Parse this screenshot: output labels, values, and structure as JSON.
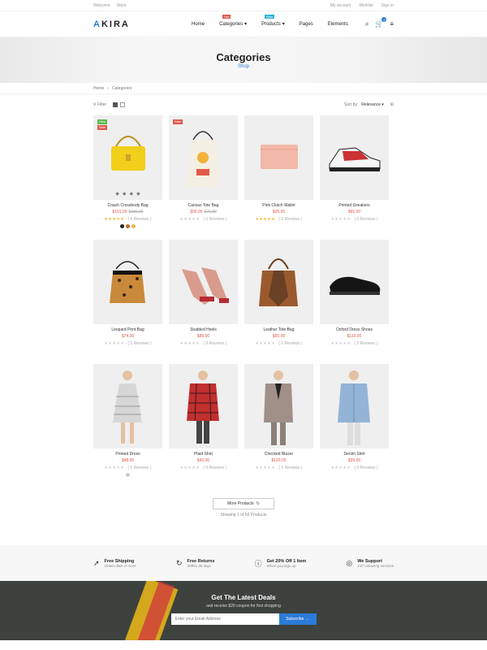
{
  "topbar": {
    "left": [
      "Welcome",
      "Store"
    ],
    "right": [
      "My account",
      "Wishlist",
      "Sign in"
    ]
  },
  "header": {
    "logo_a": "A",
    "logo_rest": "KIRA",
    "cart_count": "2",
    "nav": [
      {
        "label": "Home",
        "tag": ""
      },
      {
        "label": "Categories",
        "tag": "Hot",
        "tag_color": "#e0584b"
      },
      {
        "label": "Products",
        "tag": "New",
        "tag_color": "#2bb2d8"
      },
      {
        "label": "Pages",
        "tag": ""
      },
      {
        "label": "Elements",
        "tag": ""
      }
    ]
  },
  "hero": {
    "title": "Categories",
    "subtitle": "Shop"
  },
  "breadcrumb": {
    "home": "Home",
    "sep": "›",
    "current": "Categories"
  },
  "toolbar": {
    "filter": "Filter",
    "sort_label": "Sort by:",
    "sort_value": "Relevance"
  },
  "products": [
    {
      "name": "Coach Crossbody Bag",
      "price": "$101.00",
      "old": "$180.00",
      "badges": [
        {
          "t": "New",
          "c": "#59b84f"
        },
        {
          "t": "Sale",
          "c": "#e0584b"
        }
      ],
      "stars": "★★★★★",
      "gold": true,
      "reviews": "( 4 Reviews )",
      "swatches": [
        "#222",
        "#c06a2a",
        "#e8b64a"
      ],
      "img": "yellowbag"
    },
    {
      "name": "Canvas Tote Bag",
      "price": "$55.00",
      "old": "$70.00",
      "badges": [
        {
          "t": "Sale",
          "c": "#e0584b"
        }
      ],
      "stars": "★★★★★",
      "gold": false,
      "reviews": "( 0 Reviews )",
      "swatches": [],
      "img": "tote"
    },
    {
      "name": "Pink Clutch Wallet",
      "price": "$35.00",
      "old": "",
      "badges": [],
      "stars": "★★★★★",
      "gold": true,
      "reviews": "( 2 Reviews )",
      "swatches": [],
      "img": "clutch"
    },
    {
      "name": "Printed Sneakers",
      "price": "$65.00",
      "old": "",
      "badges": [],
      "stars": "★★★★★",
      "gold": false,
      "reviews": "( 0 Reviews )",
      "swatches": [],
      "img": "sneaker"
    },
    {
      "name": "Leopard Print Bag",
      "price": "$74.00",
      "old": "",
      "badges": [],
      "stars": "★★★★★",
      "gold": false,
      "reviews": "( 0 Reviews )",
      "swatches": [],
      "img": "leopard"
    },
    {
      "name": "Studded Heels",
      "price": "$89.00",
      "old": "",
      "badges": [],
      "stars": "★★★★★",
      "gold": false,
      "reviews": "( 0 Reviews )",
      "swatches": [],
      "img": "heels"
    },
    {
      "name": "Leather Tote Bag",
      "price": "$95.00",
      "old": "",
      "badges": [],
      "stars": "★★★★★",
      "gold": false,
      "reviews": "( 0 Reviews )",
      "swatches": [],
      "img": "brownbag"
    },
    {
      "name": "Oxford Dress Shoes",
      "price": "$110.00",
      "old": "",
      "badges": [],
      "stars": "★★★★★",
      "gold": false,
      "reviews": "( 0 Reviews )",
      "swatches": [],
      "img": "shoe"
    },
    {
      "name": "Printed Dress",
      "price": "$48.00",
      "old": "",
      "badges": [],
      "stars": "★★★★★",
      "gold": false,
      "reviews": "( 0 Reviews )",
      "swatches": [
        "#ccc"
      ],
      "img": "dress"
    },
    {
      "name": "Plaid Shirt",
      "price": "$42.00",
      "old": "",
      "badges": [],
      "stars": "★★★★★",
      "gold": false,
      "reviews": "( 0 Reviews )",
      "swatches": [],
      "img": "plaid"
    },
    {
      "name": "Checked Blazer",
      "price": "$120.00",
      "old": "",
      "badges": [],
      "stars": "★★★★★",
      "gold": false,
      "reviews": "( 0 Reviews )",
      "swatches": [],
      "img": "blazer"
    },
    {
      "name": "Denim Shirt",
      "price": "$39.00",
      "old": "",
      "badges": [],
      "stars": "★★★★★",
      "gold": false,
      "reviews": "( 0 Reviews )",
      "swatches": [],
      "img": "denim"
    }
  ],
  "more": {
    "label": "More Products",
    "showing": "Showing 1 of 56 Products"
  },
  "features": [
    {
      "icon": "rocket-icon",
      "glyph": "➚",
      "title": "Free Shipping",
      "desc": "Orders $50 or more"
    },
    {
      "icon": "return-icon",
      "glyph": "↻",
      "title": "Free Returns",
      "desc": "Within 30 days"
    },
    {
      "icon": "info-icon",
      "glyph": "ⓘ",
      "title": "Get 20% Off 1 Item",
      "desc": "When you sign up"
    },
    {
      "icon": "support-icon",
      "glyph": "◎",
      "title": "We Support",
      "desc": "24/7 amazing services"
    }
  ],
  "newsletter": {
    "title": "Get The Latest Deals",
    "text": "and receive $20 coupon for first shopping",
    "placeholder": "Enter your Email Address",
    "button": "Subscribe →"
  }
}
